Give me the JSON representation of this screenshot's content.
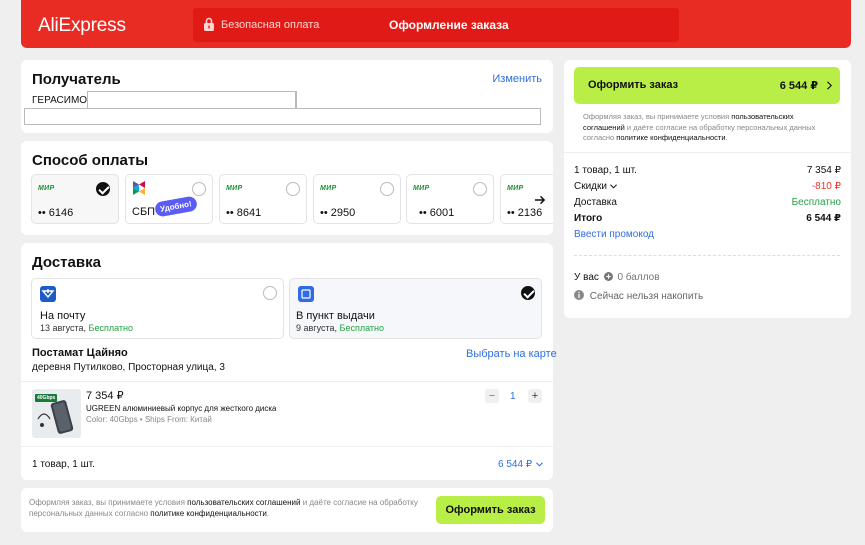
{
  "header": {
    "logo": "AliExpress",
    "secure_payment": "Безопасная оплата",
    "title": "Оформление заказа"
  },
  "recipient": {
    "title": "Получатель",
    "edit_link": "Изменить",
    "last_name": "ГЕРАСИМОВ"
  },
  "payment": {
    "title": "Способ оплаты",
    "methods": [
      {
        "logo": "МИР",
        "number": "•• 6146"
      },
      {
        "label": "СБП",
        "badge": "Удобно!"
      },
      {
        "logo": "МИР",
        "number": "•• 8641"
      },
      {
        "logo": "МИР",
        "number": "•• 2950"
      },
      {
        "logo": "МИР",
        "number": "•• 6001"
      },
      {
        "logo": "МИР",
        "number": "•• 2136"
      }
    ],
    "arrow_icon": "arrow-right-icon"
  },
  "delivery": {
    "title": "Доставка",
    "options": [
      {
        "title": "На почту",
        "date": "13 августа,",
        "price": "Бесплатно"
      },
      {
        "title": "В пункт выдачи",
        "date": "9 августа,",
        "price": "Бесплатно"
      }
    ],
    "pickup_name": "Постамат Цайняо",
    "pickup_map_link": "Выбрать на карте",
    "pickup_address": "деревня Путилково, Просторная улица, 3",
    "item": {
      "price": "7 354 ₽",
      "name": "UGREEN алюминиевый корпус для жесткого диска",
      "attrs": "Color: 40Gbps • Ships From: Китай",
      "quantity": "1",
      "image_text": "40Gbps"
    },
    "total_count": "1 товар, 1 шт.",
    "total_price": "6 544 ₽"
  },
  "footer": {
    "terms_prefix": "Оформляя заказ, вы принимаете условия ",
    "terms_link": "пользовательских соглашений",
    "terms_middle": " и даёте согласие на обработку персональных данных согласно ",
    "privacy_link": "политике конфиденциальности",
    "terms_end": ".",
    "button": "Оформить заказ"
  },
  "summary": {
    "button_label": "Оформить заказ",
    "button_price": "6 544 ₽",
    "terms_prefix": "Оформляя заказ, вы принимаете условия ",
    "terms_link": "пользовательских соглашений",
    "terms_middle": " и даёте согласие на обработку персональных данных согласно ",
    "privacy_link": "политике конфиденциальности",
    "terms_end": ".",
    "items_label": "1 товар, 1 шт.",
    "items_value": "7 354 ₽",
    "discount_label": "Скидки",
    "discount_value": "-810 ₽",
    "delivery_label": "Доставка",
    "delivery_value": "Бесплатно",
    "total_label": "Итого",
    "total_value": "6 544 ₽",
    "promo_link": "Ввести промокод",
    "points_prefix": "У вас",
    "points_value": "0 баллов",
    "accrual_note": "Сейчас нельзя накопить"
  },
  "colors": {
    "brand": "#e92c23",
    "accent_button": "#b8ee45",
    "link": "#2e6fde",
    "free": "#22a13f",
    "discount": "#e8342a"
  }
}
